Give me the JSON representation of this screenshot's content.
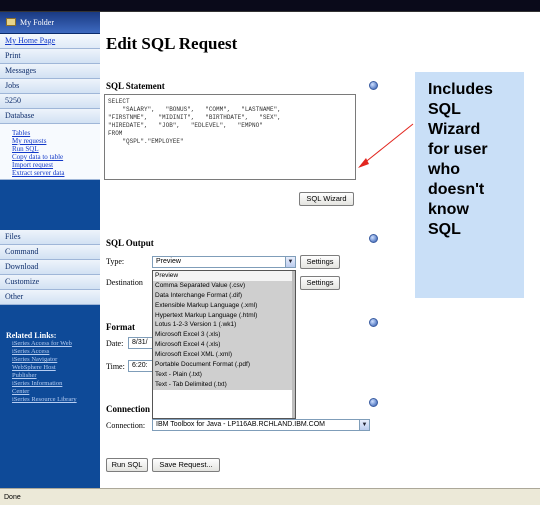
{
  "window": {
    "title_partial": "Edit SQL Request",
    "url_partial": ""
  },
  "sidebar": {
    "my_folder": "My Folder",
    "items": [
      {
        "label": "My Home Page",
        "link": true
      },
      {
        "label": "Print"
      },
      {
        "label": "Messages"
      },
      {
        "label": "Jobs"
      },
      {
        "label": "5250"
      },
      {
        "label": "Database"
      }
    ],
    "database_sub": [
      "Tables",
      "My requests",
      "Run SQL",
      "Copy data to table",
      "Import request",
      "Extract server data"
    ],
    "items2": [
      {
        "label": "Files"
      },
      {
        "label": "Command"
      },
      {
        "label": "Download"
      },
      {
        "label": "Customize"
      },
      {
        "label": "Other"
      }
    ],
    "related": {
      "heading": "Related Links:",
      "links": [
        "iSeries Access for Web",
        "iSeries Access",
        "iSeries Navigator",
        "WebSphere Host",
        "Publisher",
        "iSeries Information",
        "Center",
        "iSeries Resource Library"
      ]
    }
  },
  "main": {
    "title": "Edit SQL Request",
    "sql_statement_label": "SQL Statement",
    "sql_text": "SELECT\n    \"SALARY\",   \"BONUS\",   \"COMM\",   \"LASTNAME\",\n\"FIRSTNME\",   \"MIDINIT\",   \"BIRTHDATE\",   \"SEX\",\n\"HIREDATE\",   \"JOB\",   \"EDLEVEL\",   \"EMPNO\"\nFROM\n    \"QSPL\".\"EMPLOYEE\"",
    "sql_wizard_button": "SQL Wizard",
    "sql_output_label": "SQL Output",
    "type_label": "Type:",
    "type_value": "Preview",
    "destination_label": "Destination",
    "settings_button": "Settings",
    "dropdown_options": [
      "Preview",
      "Comma Separated Value (.csv)",
      "Data Interchange Format (.dif)",
      "Extensible Markup Language (.xml)",
      "Hypertext Markup Language (.html)",
      "Lotus 1-2-3 Version 1 (.wk1)",
      "Microsoft Excel 3 (.xls)",
      "Microsoft Excel 4 (.xls)",
      "Microsoft Excel XML (.xml)",
      "Portable Document Format (.pdf)",
      "Text - Plain (.txt)",
      "Text - Tab Delimited (.txt)"
    ],
    "format_label": "Format",
    "date_label": "Date:",
    "date_value": "8/31/",
    "time_label": "Time:",
    "time_value": "6:20:",
    "connection_section_label": "Connection",
    "connection_label": "Connection:",
    "connection_value": "IBM Toolbox for Java - LP116AB.RCHLAND.IBM.COM",
    "run_sql_button": "Run SQL",
    "save_request_button": "Save Request..."
  },
  "callout": {
    "lines": [
      "Includes",
      "SQL",
      "Wizard",
      "for user",
      "who",
      "doesn't",
      "know",
      "SQL"
    ]
  },
  "status_bar": {
    "text": "Done"
  }
}
